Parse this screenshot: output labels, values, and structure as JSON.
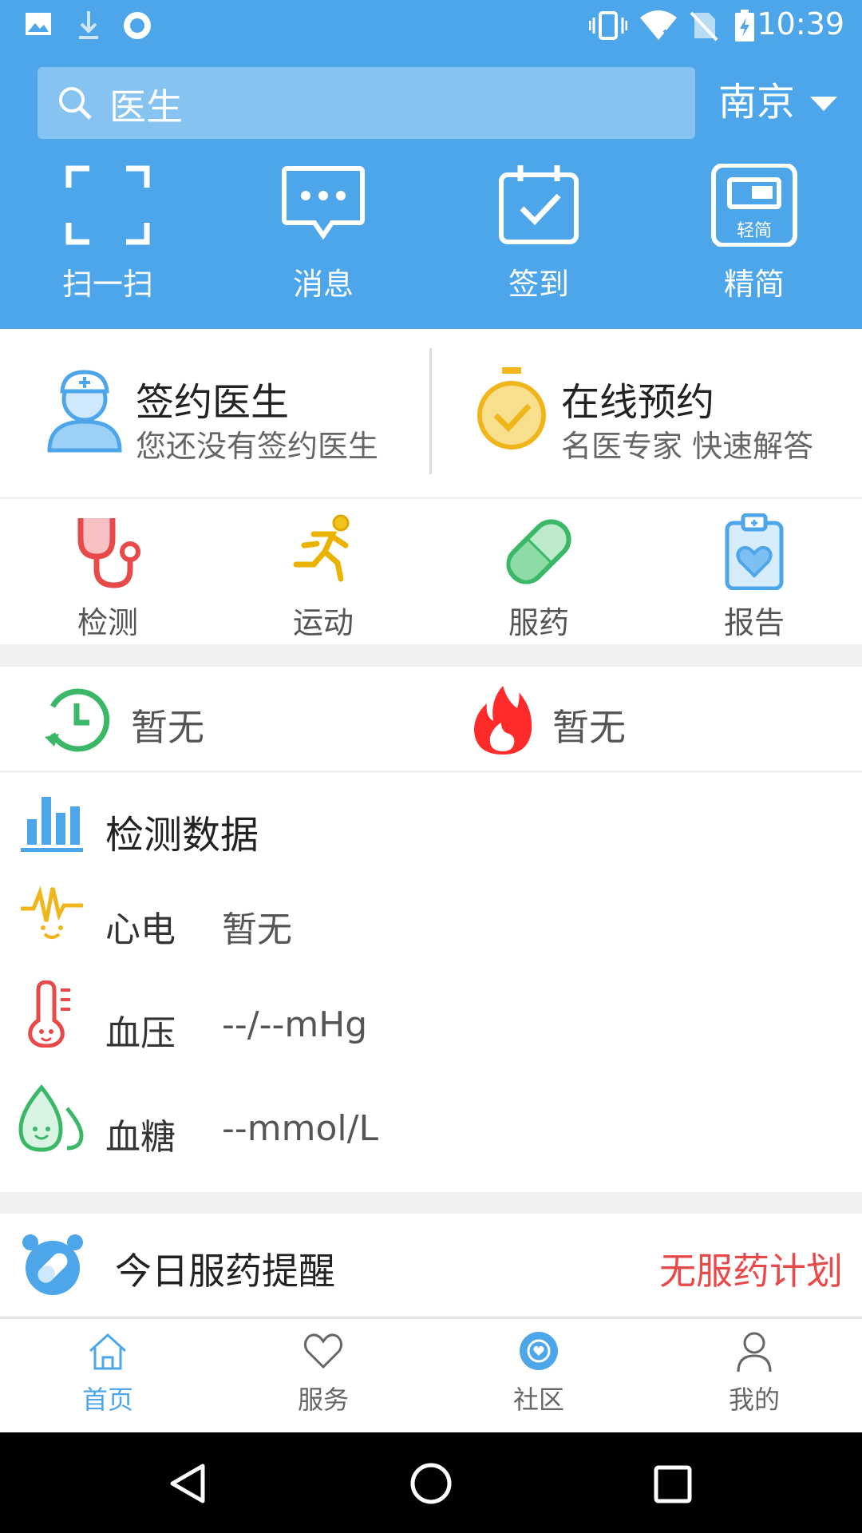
{
  "status_bar": {
    "time": "10:39"
  },
  "search": {
    "placeholder": "医生"
  },
  "city": {
    "label": "南京"
  },
  "quick_actions": [
    {
      "label": "扫一扫",
      "icon": "scan-icon"
    },
    {
      "label": "消息",
      "icon": "message-icon"
    },
    {
      "label": "签到",
      "icon": "checkin-icon"
    },
    {
      "label": "精简",
      "icon": "simple-mode-icon",
      "badge": "轻简"
    }
  ],
  "doctor_cards": [
    {
      "title": "签约医生",
      "subtitle": "您还没有签约医生",
      "icon": "doctor-icon"
    },
    {
      "title": "在线预约",
      "subtitle": "名医专家 快速解答",
      "icon": "stopwatch-icon"
    }
  ],
  "services": [
    {
      "label": "检测",
      "icon": "stethoscope-icon"
    },
    {
      "label": "运动",
      "icon": "running-icon"
    },
    {
      "label": "服药",
      "icon": "pill-icon"
    },
    {
      "label": "报告",
      "icon": "report-icon"
    }
  ],
  "recent": [
    {
      "value": "暂无",
      "icon": "clock-icon"
    },
    {
      "value": "暂无",
      "icon": "fire-icon"
    }
  ],
  "detection": {
    "title": "检测数据",
    "rows": [
      {
        "label": "心电",
        "value": "暂无",
        "icon": "ecg-icon"
      },
      {
        "label": "血压",
        "value": "--/--mHg",
        "icon": "thermometer-icon"
      },
      {
        "label": "血糖",
        "value": "--mmol/L",
        "icon": "drop-icon"
      }
    ]
  },
  "reminder": {
    "title": "今日服药提醒",
    "status": "无服药计划"
  },
  "tabs": [
    {
      "label": "首页",
      "icon": "home-icon",
      "active": true
    },
    {
      "label": "服务",
      "icon": "heart-icon",
      "active": false
    },
    {
      "label": "社区",
      "icon": "community-icon",
      "active": false
    },
    {
      "label": "我的",
      "icon": "profile-icon",
      "active": false
    }
  ],
  "colors": {
    "primary": "#4ea6ea",
    "alert_red": "#e84a4a",
    "tab_active": "#4ea6ea",
    "tab_inactive": "#666666"
  }
}
